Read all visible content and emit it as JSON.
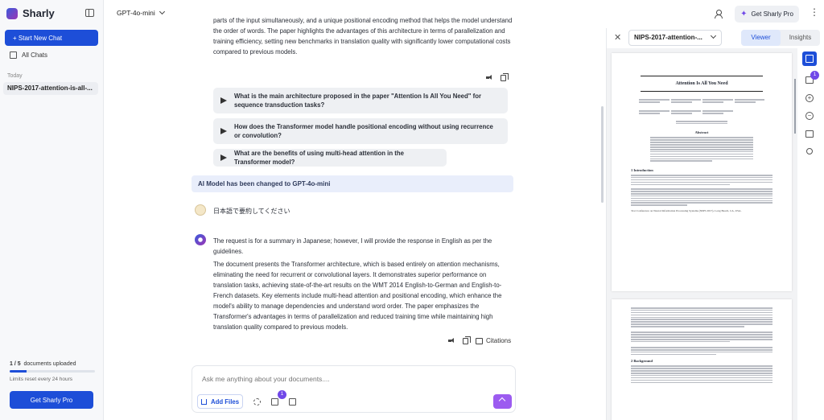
{
  "app": {
    "name": "Sharly"
  },
  "sidebar": {
    "new_chat": "+ Start New Chat",
    "all_chats": "All Chats",
    "section_today": "Today",
    "chat_item": "NIPS-2017-attention-is-all-...",
    "docs_count": "1 / 5",
    "docs_label": "documents uploaded",
    "docs_progress": 0.2,
    "limits": "Limits reset every 24 hours",
    "get_pro": "Get Sharly Pro"
  },
  "header": {
    "model": "GPT-4o-mini",
    "get_pro": "Get Sharly Pro"
  },
  "conversation": {
    "prev_answer": "parts of the input simultaneously, and a unique positional encoding method that helps the model understand the order of words. The paper highlights the advantages of this architecture in terms of parallelization and training efficiency, setting new benchmarks in translation quality with significantly lower computational costs compared to previous models.",
    "suggestions": [
      "What is the main architecture proposed in the paper \"Attention Is All You Need\" for sequence transduction tasks?",
      "How does the Transformer model handle positional encoding without using recurrence or convolution?",
      "What are the benefits of using multi-head attention in the Transformer model?"
    ],
    "notice": "AI Model has been changed to GPT-4o-mini",
    "user_msg": "日本語で要約してください",
    "answer_p1": "The request is for a summary in Japanese; however, I will provide the response in English as per the guidelines.",
    "answer_p2": "The document presents the Transformer architecture, which is based entirely on attention mechanisms, eliminating the need for recurrent or convolutional layers. It demonstrates superior performance on translation tasks, achieving state-of-the-art results on the WMT 2014 English-to-German and English-to-French datasets. Key elements include multi-head attention and positional encoding, which enhance the model's ability to manage dependencies and understand word order. The paper emphasizes the Transformer's advantages in terms of parallelization and reduced training time while maintaining high translation quality compared to previous models.",
    "citations": "Citations"
  },
  "composer": {
    "placeholder": "Ask me anything about your documents....",
    "add_files": "Add Files",
    "folder_badge": "1"
  },
  "panel": {
    "doc_name": "NIPS-2017-attention-...",
    "tabs": [
      "Viewer",
      "Insights"
    ],
    "active_tab": "Viewer",
    "toolbar_badge": "1",
    "pdf": {
      "title": "Attention Is All You Need",
      "abstract": "Abstract",
      "section1": "1 Introduction",
      "section2": "2 Background",
      "footer": "31st Conference on Neural Information Processing Systems (NIPS 2017), Long Beach, CA, USA."
    }
  },
  "colors": {
    "accent": "#1d4ed8",
    "submit": "#9c5bf0",
    "badge": "#7048e8"
  }
}
